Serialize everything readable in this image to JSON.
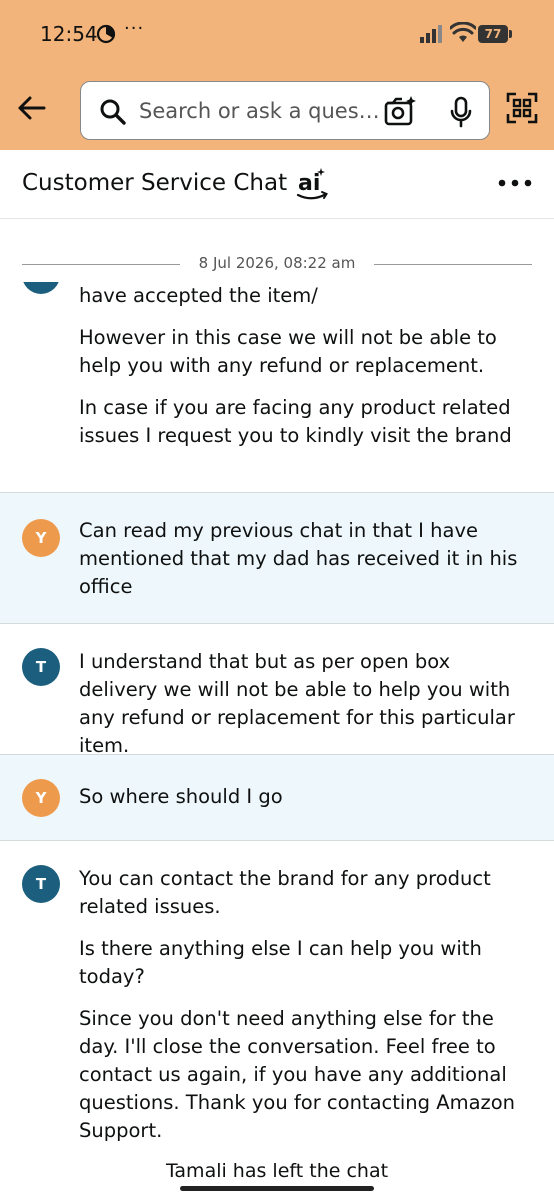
{
  "status_bar": {
    "time": "12:54",
    "dots": "···",
    "battery": "77"
  },
  "search": {
    "placeholder": "Search or ask a ques…"
  },
  "chat": {
    "title": "Customer Service Chat",
    "ai_logo_text": "ai",
    "timestamp": "8 Jul 2026, 08:22 am"
  },
  "messages": [
    {
      "sender": "agent",
      "avatar": "T",
      "paragraphs": [
        "And after thorough inspection and check you have accepted the item/",
        "However in this case we will not be able to help you with any refund or replacement.",
        "In case if you are facing any product related issues I request you to kindly visit the brand"
      ]
    },
    {
      "sender": "user",
      "avatar": "Y",
      "paragraphs": [
        "Can read my previous chat in that I have mentioned that my dad has received it in his office"
      ]
    },
    {
      "sender": "agent",
      "avatar": "T",
      "paragraphs": [
        "I understand that but as per open box delivery we will not be able to help you with any refund or replacement for this particular item."
      ]
    },
    {
      "sender": "user",
      "avatar": "Y",
      "paragraphs": [
        "So where should I go"
      ]
    },
    {
      "sender": "agent",
      "avatar": "T",
      "paragraphs": [
        "You can contact the brand for any product related issues.",
        "Is there anything else I can help you with today?",
        "Since you don't need anything else for the day. I'll close the conversation. Feel free to contact us again, if you have any additional questions. Thank you for contacting Amazon Support."
      ]
    }
  ],
  "left_note": "Tamali has left the chat",
  "colors": {
    "header": "#f2b47a",
    "agent_avatar": "#1b5e7e",
    "user_avatar": "#ee9a4d",
    "user_bubble_bg": "#eef7fb"
  },
  "icons": [
    "back-arrow-icon",
    "search-icon",
    "camera-search-icon",
    "microphone-icon",
    "qr-scan-icon",
    "more-options-icon"
  ]
}
